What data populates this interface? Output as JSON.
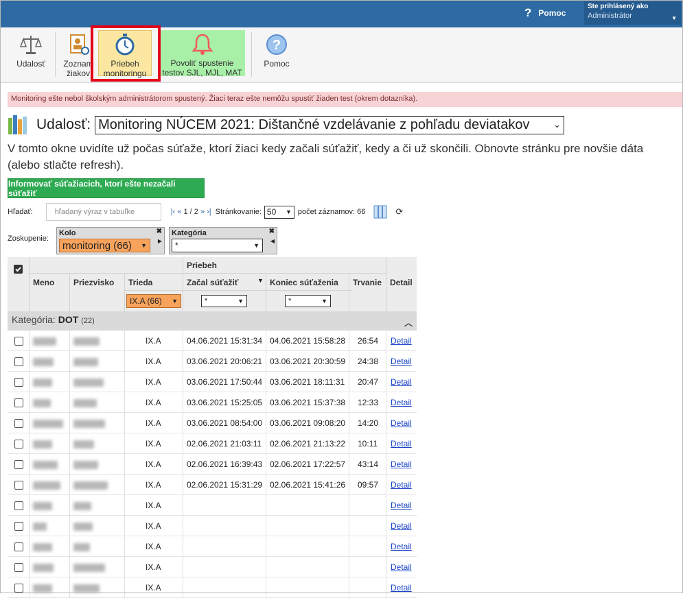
{
  "header": {
    "help_label": "Pomoc",
    "user_label": "Ste prihlásený ako",
    "user_role": "Administrátor"
  },
  "toolbar": {
    "event": "Udalosť",
    "students_line1": "Zoznam",
    "students_line2": "žiakov",
    "progress_line1": "Priebeh",
    "progress_line2": "monitoringu",
    "enable_line1": "Povoliť spustenie",
    "enable_line2": "testov SJL, MJL, MAT",
    "help": "Pomoc"
  },
  "alert": "Monitoring ešte nebol školským administrátorom spustený. Žiaci teraz ešte nemôžu spustiť žiaden test (okrem dotazníka).",
  "event": {
    "label": "Udalosť:",
    "selected": "Monitoring NÚCEM 2021: Dištančné vzdelávanie z pohľadu deviatakov"
  },
  "description_line1": "V tomto okne uvidíte už počas súťaže, ktorí žiaci kedy začali súťažiť, kedy a či už skončili. Obnovte stránku pre novšie dáta",
  "description_line2": "(alebo stlačte refresh).",
  "notify_button": "Informovať súťažiacich, ktorí ešte nezačali súťažiť",
  "search": {
    "label": "Hľadať:",
    "placeholder": "hľadaný výraz v tabuľke",
    "pager_text": "1 / 2",
    "page_size_label": "Stránkovanie:",
    "page_size": "50",
    "count_label": "počet záznamov: 66"
  },
  "grouping": {
    "label": "Zoskupenie:",
    "group1_title": "Kolo",
    "group1_value": "monitoring (66)",
    "group2_title": "Kategória",
    "group2_value": "*"
  },
  "table": {
    "group_header": "Priebeh",
    "columns": {
      "name": "Meno",
      "surname": "Priezvisko",
      "class": "Trieda",
      "started": "Začal súťažiť",
      "ended": "Koniec súťaženia",
      "duration": "Trvanie",
      "detail": "Detail"
    },
    "filters": {
      "class": "IX.A (66)",
      "started": "*",
      "ended": "*"
    },
    "category_label": "Kategória:",
    "category_name": "DOT",
    "category_count": "(22)",
    "rows": [
      {
        "class": "IX.A",
        "start": "04.06.2021 15:31:34",
        "end": "04.06.2021 15:58:28",
        "dur": "26:54",
        "detail": "Detail"
      },
      {
        "class": "IX.A",
        "start": "03.06.2021 20:06:21",
        "end": "03.06.2021 20:30:59",
        "dur": "24:38",
        "detail": "Detail"
      },
      {
        "class": "IX.A",
        "start": "03.06.2021 17:50:44",
        "end": "03.06.2021 18:11:31",
        "dur": "20:47",
        "detail": "Detail"
      },
      {
        "class": "IX.A",
        "start": "03.06.2021 15:25:05",
        "end": "03.06.2021 15:37:38",
        "dur": "12:33",
        "detail": "Detail"
      },
      {
        "class": "IX.A",
        "start": "03.06.2021 08:54:00",
        "end": "03.06.2021 09:08:20",
        "dur": "14:20",
        "detail": "Detail"
      },
      {
        "class": "IX.A",
        "start": "02.06.2021 21:03:11",
        "end": "02.06.2021 21:13:22",
        "dur": "10:11",
        "detail": "Detail"
      },
      {
        "class": "IX.A",
        "start": "02.06.2021 16:39:43",
        "end": "02.06.2021 17:22:57",
        "dur": "43:14",
        "detail": "Detail"
      },
      {
        "class": "IX.A",
        "start": "02.06.2021 15:31:29",
        "end": "02.06.2021 15:41:26",
        "dur": "09:57",
        "detail": "Detail"
      },
      {
        "class": "IX.A",
        "start": "",
        "end": "",
        "dur": "",
        "detail": "Detail"
      },
      {
        "class": "IX.A",
        "start": "",
        "end": "",
        "dur": "",
        "detail": "Detail"
      },
      {
        "class": "IX.A",
        "start": "",
        "end": "",
        "dur": "",
        "detail": "Detail"
      },
      {
        "class": "IX.A",
        "start": "",
        "end": "",
        "dur": "",
        "detail": "Detail"
      },
      {
        "class": "IX.A",
        "start": "",
        "end": "",
        "dur": "",
        "detail": "Detail"
      }
    ]
  }
}
